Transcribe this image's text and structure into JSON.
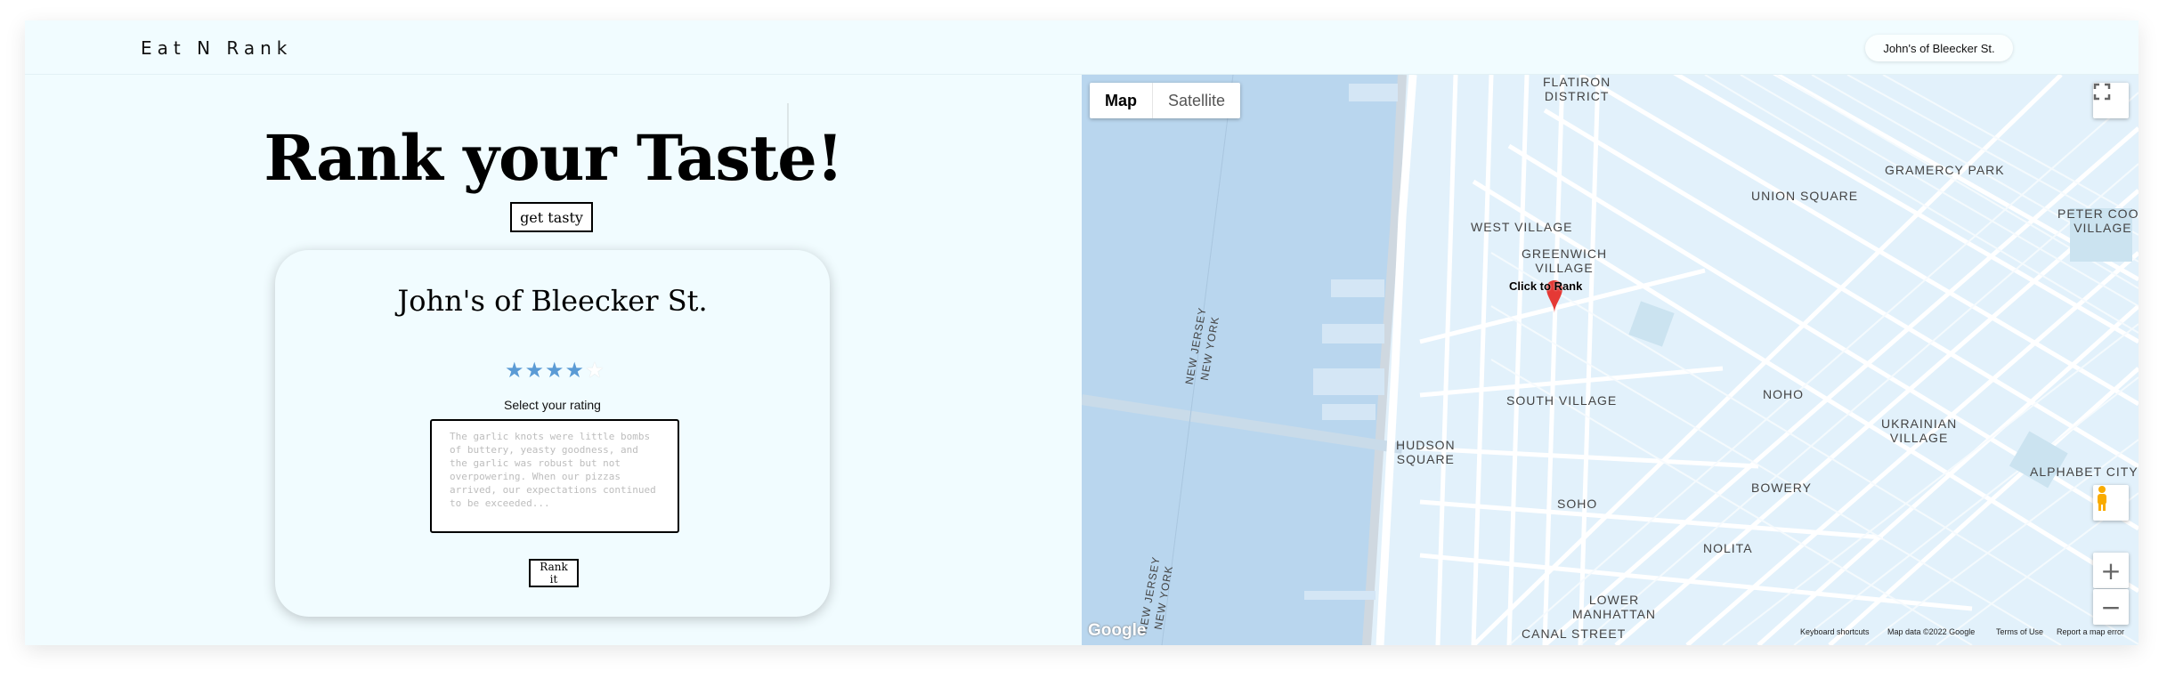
{
  "navbar": {
    "brand": "Eat N Rank",
    "pill": "John's of Bleecker St."
  },
  "hero": {
    "title": "Rank your Taste!",
    "button": "get tasty"
  },
  "card": {
    "title": "John's of Bleecker St.",
    "rating": 4,
    "rating_max": 5,
    "rating_label": "Select your rating",
    "review_placeholder": "The garlic knots were little bombs of buttery, yeasty goodness, and the garlic was robust but not overpowering. When our pizzas arrived, our expectations continued to be exceeded...",
    "submit": "Rank it"
  },
  "map": {
    "type_map": "Map",
    "type_satellite": "Satellite",
    "marker_label": "Click to Rank",
    "labels": {
      "flatiron": "FLATIRON\nDISTRICT",
      "gramercy": "GRAMERCY PARK",
      "union_square": "UNION SQUARE",
      "peter_cooper": "PETER COOP\nVILLAGE",
      "west_village": "WEST VILLAGE",
      "greenwich": "GREENWICH\nVILLAGE",
      "noho": "NOHO",
      "ukrainian": "UKRAINIAN\nVILLAGE",
      "alphabet": "ALPHABET CITY",
      "south_village": "SOUTH VILLAGE",
      "hudson_square": "HUDSON\nSQUARE",
      "soho": "SOHO",
      "bowery": "BOWERY",
      "nolita": "NOLITA",
      "lower_manhattan": "LOWER\nMANHATTAN",
      "canal_street": "CANAL STREET",
      "nj1": "NEW JERSEY\nNEW YORK",
      "nj2": "NEW JERSEY\nNEW YORK"
    },
    "logo": "Google",
    "keyboard_shortcuts": "Keyboard shortcuts",
    "map_data": "Map data ©2022 Google",
    "terms": "Terms of Use",
    "report": "Report a map error",
    "fullscreen_icon": "fullscreen-icon",
    "pegman_icon": "pegman-icon",
    "zoom_in": "+",
    "zoom_out": "−"
  }
}
